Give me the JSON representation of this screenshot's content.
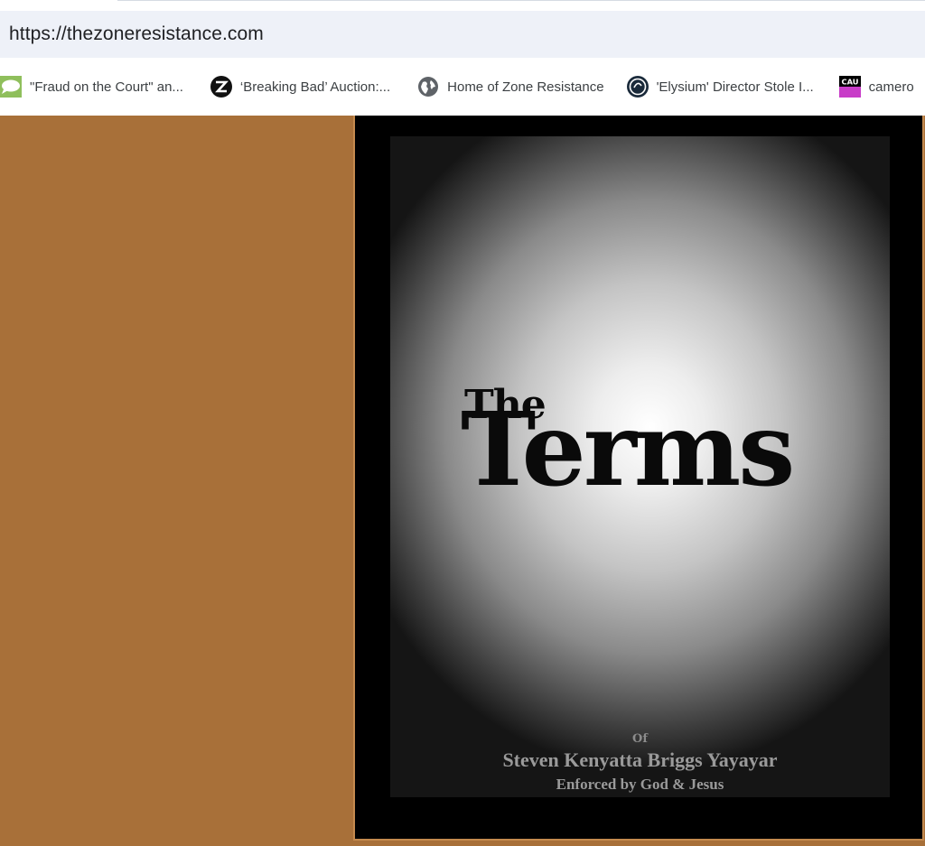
{
  "browser": {
    "url": "https://thezoneresistance.com"
  },
  "bookmarks": [
    {
      "label": "\"Fraud on the Court\" an...",
      "icon": "speech-bubble-icon",
      "color": "#7aa84a"
    },
    {
      "label": "‘Breaking Bad’ Auction:...",
      "icon": "bb-logo-icon",
      "color": "#111111"
    },
    {
      "label": "Home of Zone Resistance",
      "icon": "globe-icon",
      "color": "#5f6368"
    },
    {
      "label": "'Elysium' Director Stole I...",
      "icon": "circle-logo-icon",
      "color": "#1a2a3a"
    },
    {
      "label": "camero",
      "icon": "cau-logo-icon",
      "badge": "CAU",
      "color": "#c83cc8"
    }
  ],
  "page": {
    "background": "#a87039",
    "cover": {
      "title_small": "The",
      "title_large": "Terms",
      "of": "Of",
      "author": "Steven Kenyatta Briggs Yayayar",
      "enforced": "Enforced by God & Jesus"
    }
  }
}
